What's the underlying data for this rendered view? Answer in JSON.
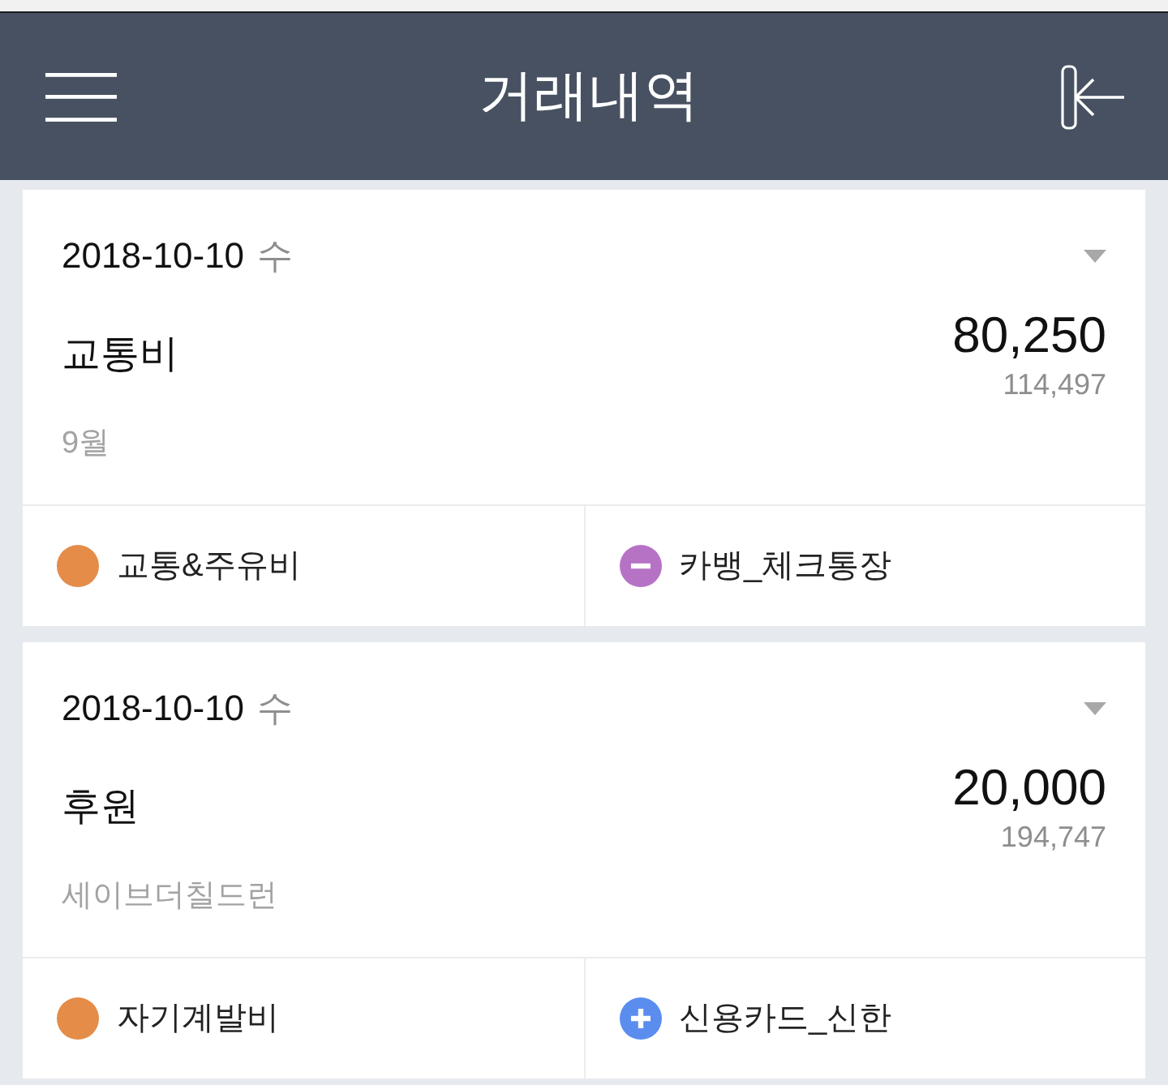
{
  "header": {
    "title": "거래내역"
  },
  "transactions": [
    {
      "date": "2018-10-10",
      "weekday": "수",
      "title": "교통비",
      "amount": "80,250",
      "balance": "114,497",
      "memo": "9월",
      "category": {
        "label": "교통&주유비",
        "color": "#e48c48"
      },
      "account": {
        "label": "카뱅_체크통장",
        "kind": "minus",
        "color": "#b673c5"
      }
    },
    {
      "date": "2018-10-10",
      "weekday": "수",
      "title": "후원",
      "amount": "20,000",
      "balance": "194,747",
      "memo": "세이브더칠드런",
      "category": {
        "label": "자기계발비",
        "color": "#e48c48"
      },
      "account": {
        "label": "신용카드_신한",
        "kind": "plus",
        "color": "#5b8def"
      }
    }
  ]
}
